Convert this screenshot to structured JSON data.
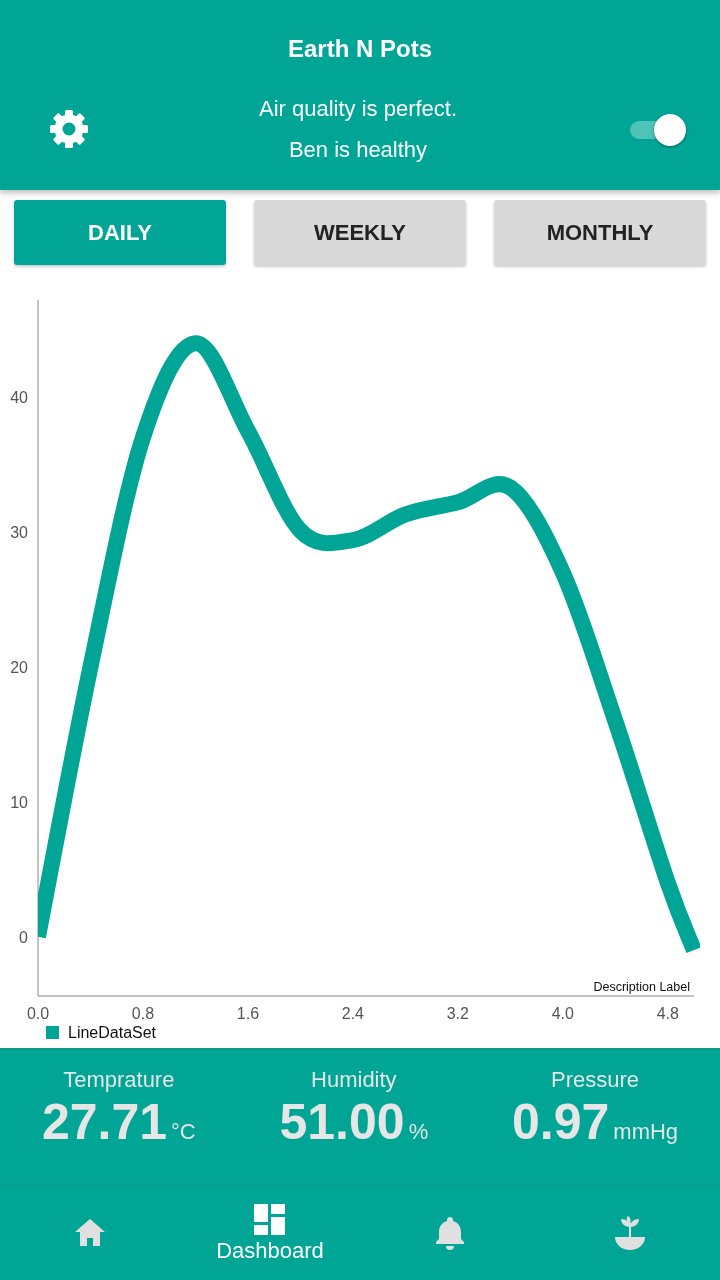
{
  "app_bar": {
    "title": "Earth N Pots",
    "status_lines": [
      "Air quality is perfect.",
      "Ben is healthy"
    ],
    "toggle": {
      "on": true
    }
  },
  "period_tabs": [
    {
      "label": "DAILY",
      "selected": true
    },
    {
      "label": "WEEKLY",
      "selected": false
    },
    {
      "label": "MONTHLY",
      "selected": false
    }
  ],
  "chart": {
    "description": "Description Label",
    "chart_data": {
      "type": "line",
      "x": [
        0,
        0.4,
        0.8,
        1.2,
        1.6,
        2.0,
        2.4,
        2.8,
        3.2,
        3.6,
        4.0,
        4.4,
        4.8,
        5.0
      ],
      "series": [
        {
          "name": "LineDataSet",
          "color": "#00a596",
          "values": [
            0,
            20,
            37,
            44,
            37.5,
            30.1,
            29.4,
            31.3,
            32.2,
            33.3,
            27,
            16,
            4,
            -1
          ]
        }
      ],
      "xlim": [
        0,
        5.0
      ],
      "ylim": [
        -4.4,
        47.2
      ],
      "xticks": [
        {
          "value": 0,
          "label": "0.0"
        },
        {
          "value": 0.8,
          "label": "0.8"
        },
        {
          "value": 1.6,
          "label": "1.6"
        },
        {
          "value": 2.4,
          "label": "2.4"
        },
        {
          "value": 3.2,
          "label": "3.2"
        },
        {
          "value": 4.0,
          "label": "4.0"
        },
        {
          "value": 4.8,
          "label": "4.8"
        }
      ],
      "yticks": [
        0,
        10,
        20,
        30,
        40
      ]
    }
  },
  "readings": [
    {
      "label": "Temprature",
      "value": "27.71",
      "unit": "°C"
    },
    {
      "label": "Humidity",
      "value": "51.00",
      "unit": "%"
    },
    {
      "label": "Pressure",
      "value": "0.97",
      "unit": "mmHg"
    }
  ],
  "bottom_nav": [
    {
      "kind": "home",
      "selected": false
    },
    {
      "kind": "dashboard",
      "label": "Dashboard",
      "selected": true
    },
    {
      "kind": "bell",
      "selected": false
    },
    {
      "kind": "plant",
      "selected": false
    }
  ]
}
